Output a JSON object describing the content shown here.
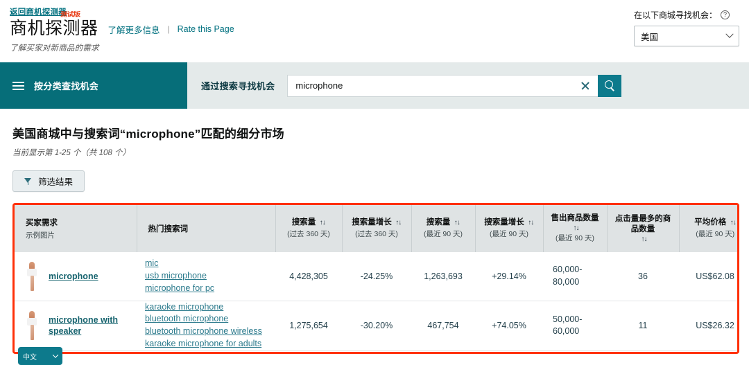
{
  "header": {
    "back_link": "返回商机探测器",
    "app_title": "商机探测器",
    "beta_badge": "测试版",
    "learn_more": "了解更多信息",
    "separator": "|",
    "rate_page": "Rate this Page",
    "subtitle": "了解买家对新商品的需求",
    "marketplace_label": "在以下商城寻找机会：",
    "help_icon": "?",
    "marketplace_value": "美国"
  },
  "nav": {
    "browse_label": "按分类查找机会",
    "search_label": "通过搜索寻找机会",
    "search_value": "microphone",
    "search_placeholder": "",
    "clear_icon": "clear-icon",
    "search_icon": "search-icon"
  },
  "results": {
    "title": "美国商城中与搜索词“microphone”匹配的细分市场",
    "count_text": "当前显示第 1-25 个（共 108 个）",
    "filter_label": "筛选结果"
  },
  "table": {
    "headers": [
      {
        "main": "买家需求",
        "sub": "示例图片",
        "sortable": false
      },
      {
        "main": "热门搜索词",
        "sub": "",
        "sortable": false
      },
      {
        "main": "搜索量",
        "sub": "(过去 360 天)",
        "sortable": true
      },
      {
        "main": "搜索量增长",
        "sub": "(过去 360 天)",
        "sortable": true
      },
      {
        "main": "搜索量",
        "sub": "(最近 90 天)",
        "sortable": true
      },
      {
        "main": "搜索量增长",
        "sub": "(最近 90 天)",
        "sortable": true
      },
      {
        "main": "售出商品数量",
        "sub": "(最近 90 天)",
        "sortable": true
      },
      {
        "main": "点击量最多的商品数量",
        "sub": "",
        "sortable": true
      },
      {
        "main": "平均价格",
        "sub": "(最近 90 天)",
        "sortable": true
      }
    ],
    "rows": [
      {
        "demand": "microphone",
        "thumb": "microphone-thumbnail",
        "terms": [
          "mic",
          "usb microphone",
          "microphone for pc"
        ],
        "search_volume_360": "4,428,305",
        "search_growth_360": "-24.25%",
        "search_volume_90": "1,263,693",
        "search_growth_90": "+29.14%",
        "units_sold_90": "60,000-80,000",
        "top_clicked_products": "36",
        "average_price_90": "US$62.08"
      },
      {
        "demand": "microphone with speaker",
        "thumb": "microphone-thumbnail",
        "terms": [
          "karaoke microphone",
          "bluetooth microphone",
          "bluetooth microphone wireless",
          "karaoke microphone for adults"
        ],
        "search_volume_360": "1,275,654",
        "search_growth_360": "-30.20%",
        "search_volume_90": "467,754",
        "search_growth_90": "+74.05%",
        "units_sold_90": "50,000-60,000",
        "top_clicked_products": "11",
        "average_price_90": "US$26.32"
      }
    ]
  },
  "overlay": {
    "lang_widget_label": "中文"
  },
  "colors": {
    "teal_dark": "#066e79",
    "teal": "#0d7a8c",
    "link": "#00707f",
    "highlight_border": "#ff3008",
    "nav_bg": "#e4eaea",
    "header_row_bg": "#dfe3e4"
  }
}
